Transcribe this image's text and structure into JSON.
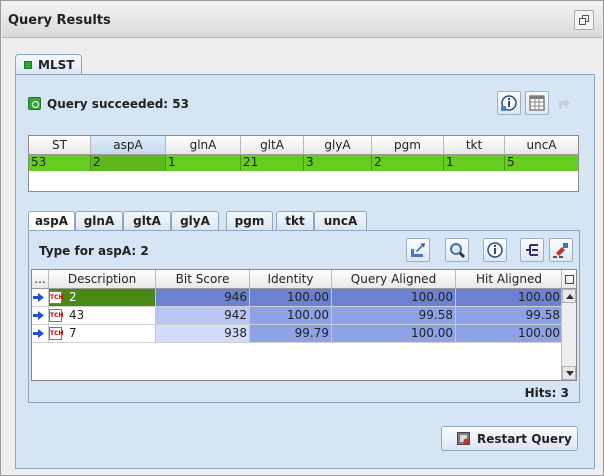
{
  "window": {
    "title": "Query Results"
  },
  "outer_tab": {
    "label": "MLST"
  },
  "status": {
    "text": "Query succeeded: 53"
  },
  "st_table": {
    "columns": [
      "ST",
      "aspA",
      "glnA",
      "gltA",
      "glyA",
      "pgm",
      "tkt",
      "uncA"
    ],
    "selected_column": "aspA",
    "row": [
      "53",
      "2",
      "1",
      "21",
      "3",
      "2",
      "1",
      "5"
    ],
    "row_color": "#66cc22"
  },
  "allele_tabs": [
    "aspA",
    "glnA",
    "gltA",
    "glyA",
    "pgm",
    "tkt",
    "uncA"
  ],
  "active_allele_tab": "aspA",
  "type_label": "Type for aspA: 2",
  "hits_table": {
    "columns": [
      "...",
      "Description",
      "Bit Score",
      "Identity",
      "Query Aligned",
      "Hit Aligned"
    ],
    "rows": [
      {
        "description": "2",
        "bit_score": "946",
        "identity": "100.00",
        "query_aligned": "100.00",
        "hit_aligned": "100.00"
      },
      {
        "description": "43",
        "bit_score": "942",
        "identity": "100.00",
        "query_aligned": "99.58",
        "hit_aligned": "99.58"
      },
      {
        "description": "7",
        "bit_score": "938",
        "identity": "99.79",
        "query_aligned": "100.00",
        "hit_aligned": "100.00"
      }
    ],
    "selected_row": 0
  },
  "hits": {
    "label": "Hits:",
    "count": "3"
  },
  "restart_button": {
    "label": "Restart Query"
  },
  "colors": {
    "panel_bg": "#d6e5f4",
    "selected_row_desc": "#4a8a14",
    "cell_blue_dark": "#6c82d0",
    "cell_blue_mid": "#8ea2e6",
    "cell_blue_light": "#b8c6f2",
    "cell_blue_pale": "#d2dcf8"
  },
  "icons": {
    "titlebar": "restore-icon",
    "toolbar_top": [
      "info-icon",
      "table-icon",
      "export-icon"
    ],
    "toolbar_allele": [
      "export-alignment-icon",
      "zoom-icon",
      "info-icon",
      "tree-icon",
      "align-icon"
    ]
  }
}
